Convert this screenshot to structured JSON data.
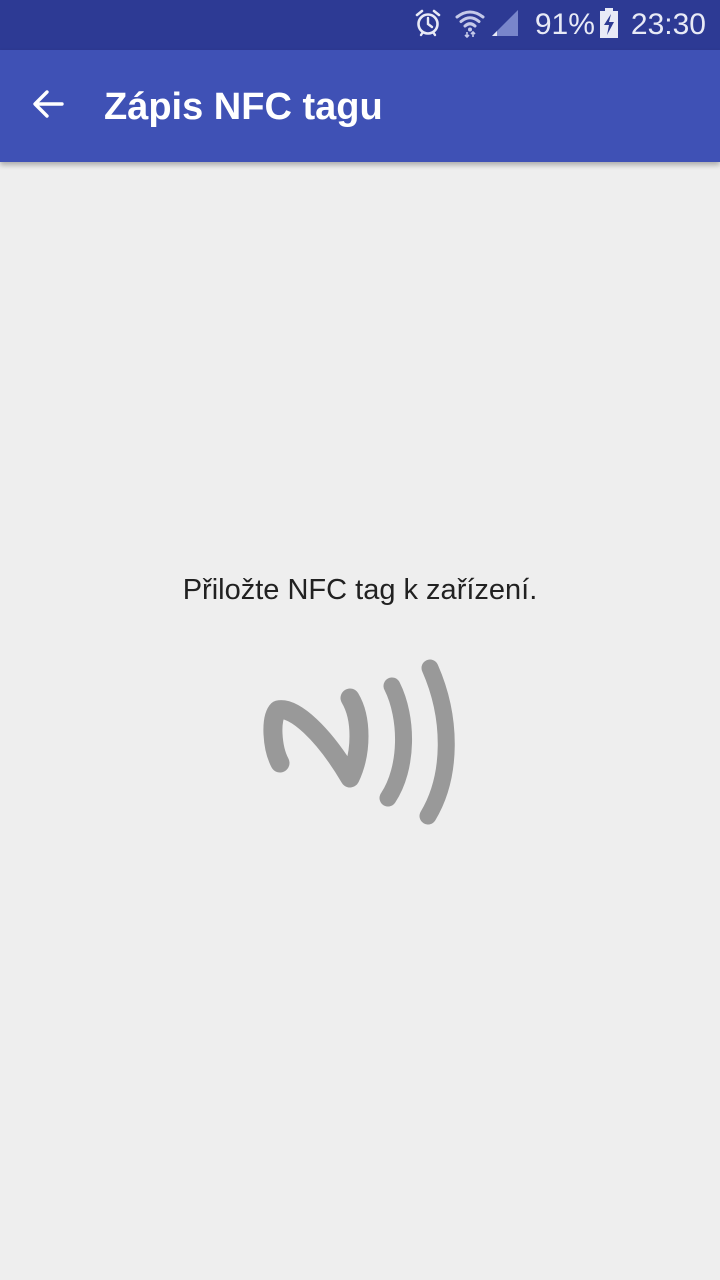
{
  "status_bar": {
    "battery_percent": "91%",
    "time": "23:30",
    "icons": [
      "alarm-icon",
      "wifi-icon",
      "signal-icon",
      "battery-charging-icon"
    ]
  },
  "app_bar": {
    "title": "Zápis NFC tagu",
    "back_icon": "arrow-back-icon"
  },
  "main": {
    "instruction": "Přiložte NFC tag k zařízení.",
    "graphic_icon": "nfc-icon"
  },
  "colors": {
    "status_bar": "#2d3a94",
    "app_bar": "#3f51b5",
    "background": "#eeeeee",
    "icon_gray": "#999999"
  }
}
